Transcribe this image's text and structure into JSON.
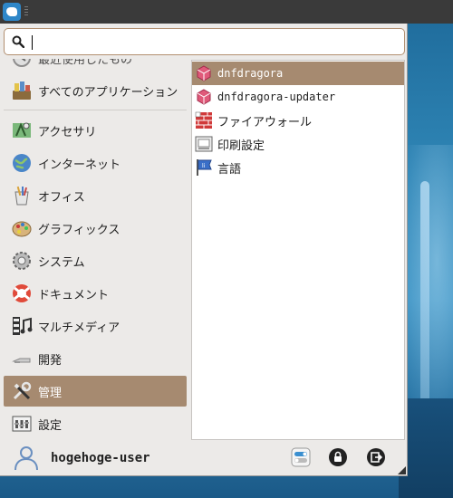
{
  "colors": {
    "selection": "#a68a70",
    "panel": "#3a3a3a",
    "menu_bg": "#eceae8",
    "search_border": "#b28f70"
  },
  "search": {
    "value": "",
    "icon": "search-icon"
  },
  "categories": [
    {
      "label": "最近使用したもの",
      "icon": "recent-icon"
    },
    {
      "label": "すべてのアプリケーション",
      "icon": "all-applications-icon"
    },
    {
      "label": "アクセサリ",
      "icon": "accessories-icon"
    },
    {
      "label": "インターネット",
      "icon": "internet-icon"
    },
    {
      "label": "オフィス",
      "icon": "office-icon"
    },
    {
      "label": "グラフィックス",
      "icon": "graphics-icon"
    },
    {
      "label": "システム",
      "icon": "system-icon"
    },
    {
      "label": "ドキュメント",
      "icon": "documentation-icon"
    },
    {
      "label": "マルチメディア",
      "icon": "multimedia-icon"
    },
    {
      "label": "開発",
      "icon": "development-icon"
    },
    {
      "label": "管理",
      "icon": "administration-icon",
      "selected": true
    },
    {
      "label": "設定",
      "icon": "settings-icon"
    }
  ],
  "apps": [
    {
      "label": "dnfdragora",
      "icon": "dnfdragora-icon",
      "selected": true
    },
    {
      "label": "dnfdragora-updater",
      "icon": "dnfdragora-updater-icon"
    },
    {
      "label": "ファイアウォール",
      "icon": "firewall-icon"
    },
    {
      "label": "印刷設定",
      "icon": "print-settings-icon"
    },
    {
      "label": "言語",
      "icon": "language-icon"
    }
  ],
  "user": {
    "name": "hogehoge-user",
    "icon": "user-avatar-icon"
  },
  "actions": [
    {
      "name": "settings-manager-button",
      "icon": "toggle-settings-icon"
    },
    {
      "name": "lock-screen-button",
      "icon": "lock-icon"
    },
    {
      "name": "log-out-button",
      "icon": "log-out-icon"
    }
  ]
}
